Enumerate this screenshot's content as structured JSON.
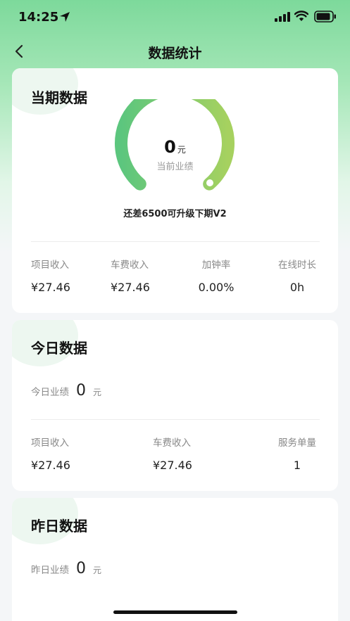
{
  "status": {
    "time": "14:25"
  },
  "nav": {
    "title": "数据统计"
  },
  "current": {
    "title": "当期数据",
    "gauge": {
      "value": "0",
      "unit": "元",
      "label": "当前业绩",
      "progress": 0.0
    },
    "tip": "还差6500可升级下期V2",
    "stats": [
      {
        "label": "项目收入",
        "value": "¥27.46"
      },
      {
        "label": "车费收入",
        "value": "¥27.46"
      },
      {
        "label": "加钟率",
        "value": "0.00%"
      },
      {
        "label": "在线时长",
        "value": "0h"
      }
    ]
  },
  "today": {
    "title": "今日数据",
    "perf_label": "今日业绩",
    "perf_value": "0",
    "perf_unit": "元",
    "stats": [
      {
        "label": "项目收入",
        "value": "¥27.46"
      },
      {
        "label": "车费收入",
        "value": "¥27.46"
      },
      {
        "label": "服务单量",
        "value": "1"
      }
    ]
  },
  "yesterday": {
    "title": "昨日数据",
    "perf_label": "昨日业绩",
    "perf_value": "0",
    "perf_unit": "元"
  },
  "colors": {
    "gauge_start": "#5cc67e",
    "gauge_end": "#a6d15f",
    "gauge_track": "#eef2ee"
  }
}
